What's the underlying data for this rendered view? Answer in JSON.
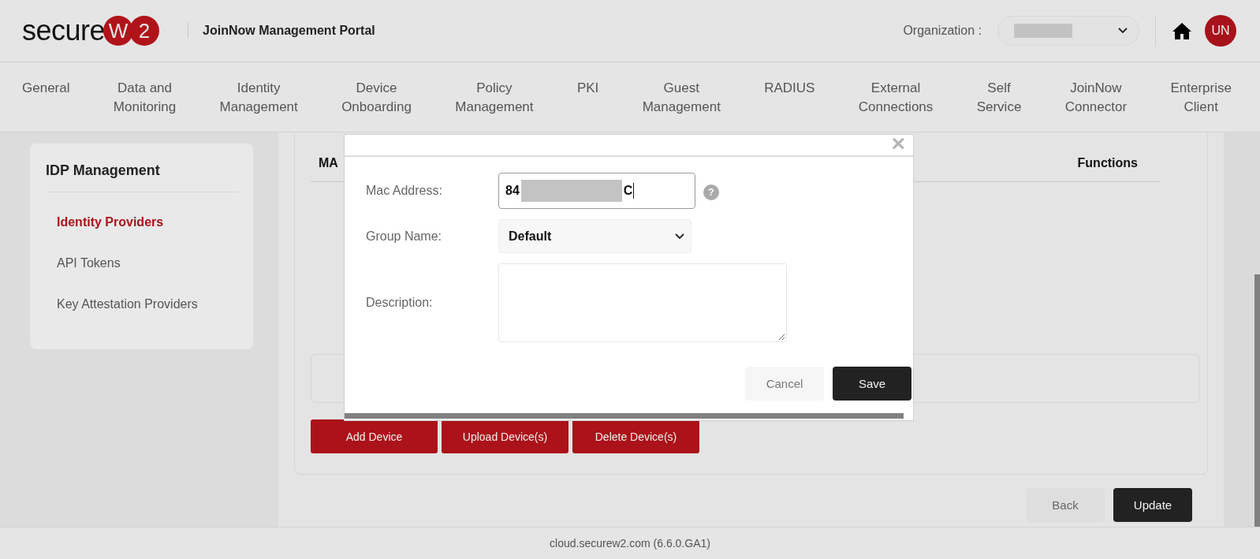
{
  "header": {
    "logo": {
      "word": "secure",
      "badges": [
        "W",
        "2"
      ]
    },
    "title": "JoinNow Management Portal",
    "organization_label": "Organization :",
    "organization_select": {
      "redacted": true
    },
    "user_avatar": "UN"
  },
  "nav": [
    {
      "label": "General"
    },
    {
      "label": "Data and\nMonitoring"
    },
    {
      "label": "Identity\nManagement"
    },
    {
      "label": "Device\nOnboarding"
    },
    {
      "label": "Policy\nManagement"
    },
    {
      "label": "PKI"
    },
    {
      "label": "Guest\nManagement"
    },
    {
      "label": "RADIUS"
    },
    {
      "label": "External\nConnections"
    },
    {
      "label": "Self\nService"
    },
    {
      "label": "JoinNow\nConnector"
    },
    {
      "label": "Enterprise\nClient"
    }
  ],
  "sidebar": {
    "title": "IDP Management",
    "items": [
      {
        "label": "Identity Providers",
        "selected": true
      },
      {
        "label": "API Tokens",
        "selected": false
      },
      {
        "label": "Key Attestation Providers",
        "selected": false
      }
    ]
  },
  "table": {
    "columns": [
      "MA",
      "Functions"
    ]
  },
  "actions": [
    "Add Device",
    "Upload Device(s)",
    "Delete Device(s)"
  ],
  "page_buttons": [
    {
      "label": "Back",
      "kind": "secondary"
    },
    {
      "label": "Update",
      "kind": "primary"
    }
  ],
  "dialog": {
    "close": "×",
    "mac_address": {
      "label": "Mac Address:",
      "value_start": "84",
      "value_end": "C",
      "redacted": true,
      "focused": true,
      "help": "?"
    },
    "group_name": {
      "label": "Group Name:",
      "value": "Default"
    },
    "description": {
      "label": "Description:"
    },
    "buttons": [
      {
        "label": "Cancel",
        "kind": "secondary"
      },
      {
        "label": "Save",
        "kind": "primary"
      }
    ]
  },
  "footer": "cloud.securew2.com (6.6.0.GA1)"
}
